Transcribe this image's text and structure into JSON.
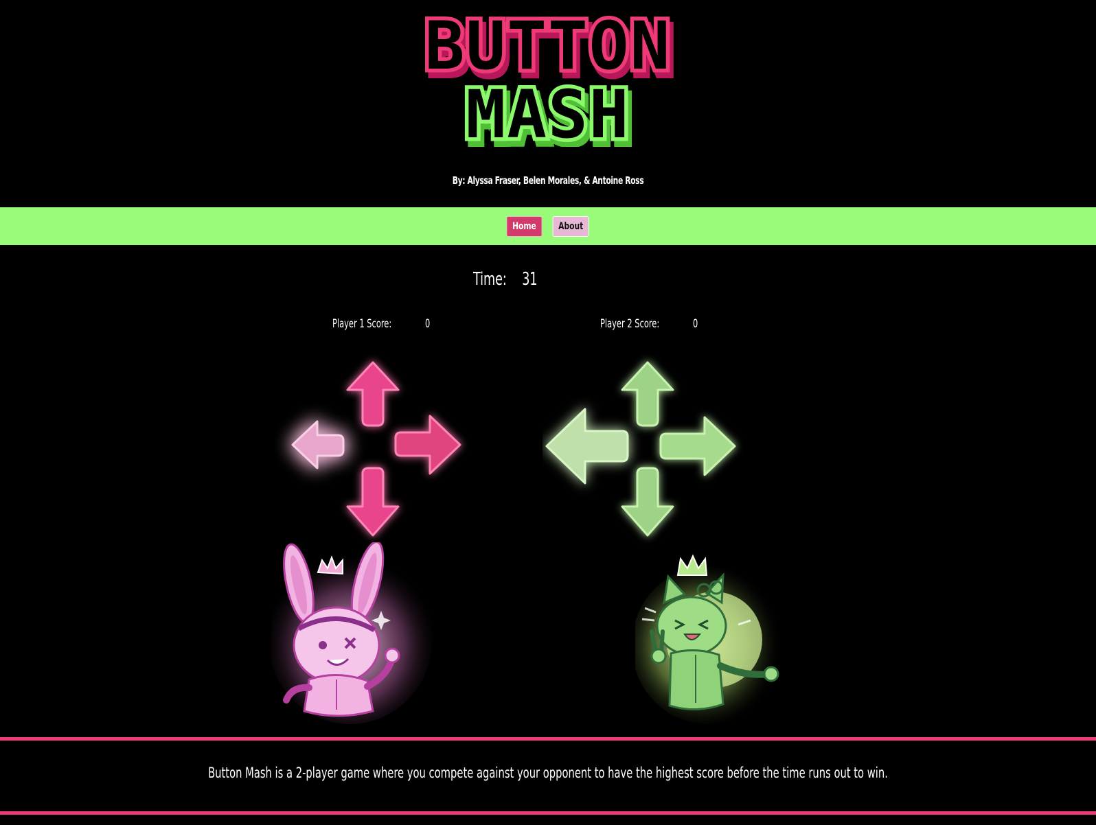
{
  "header": {
    "title_line1": "BUTTON",
    "title_line2": "MASH",
    "credits": "By: Alyssa Fraser, Belen Morales, & Antoine Ross"
  },
  "nav": {
    "home_label": "Home",
    "about_label": "About",
    "active": "Home"
  },
  "game": {
    "time_label": "Time:",
    "time_value": "31",
    "player1": {
      "score_label": "Player 1 Score:",
      "score_value": "0",
      "character": "bunny"
    },
    "player2": {
      "score_label": "Player 2 Score:",
      "score_value": "0",
      "character": "cat"
    }
  },
  "description": "Button Mash is a 2-player game where you compete against your opponent to have the highest score before the time runs out to win.",
  "colors": {
    "pink": "#ef3a78",
    "green": "#8cf86b",
    "nav_bg": "#99fb7a",
    "background": "#000000"
  }
}
